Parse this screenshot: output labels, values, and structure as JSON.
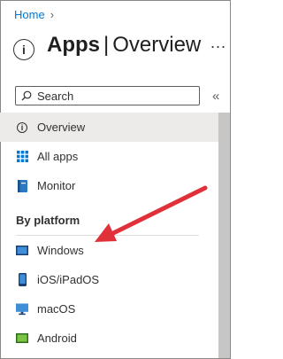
{
  "breadcrumb": {
    "home": "Home"
  },
  "header": {
    "title": "Apps",
    "separator": "|",
    "subtitle": "Overview",
    "more": "..."
  },
  "search": {
    "placeholder": "Search"
  },
  "nav": {
    "items": [
      {
        "label": "Overview",
        "icon": "info-icon"
      },
      {
        "label": "All apps",
        "icon": "grid-icon"
      },
      {
        "label": "Monitor",
        "icon": "monitor-book-icon"
      }
    ],
    "section_label": "By platform",
    "platforms": [
      {
        "label": "Windows",
        "icon": "windows-device-icon"
      },
      {
        "label": "iOS/iPadOS",
        "icon": "phone-icon"
      },
      {
        "label": "macOS",
        "icon": "desktop-icon"
      },
      {
        "label": "Android",
        "icon": "android-device-icon"
      }
    ]
  },
  "colors": {
    "accent": "#0078d4",
    "arrow": "#e0303a",
    "active_bg": "#edebe9"
  }
}
